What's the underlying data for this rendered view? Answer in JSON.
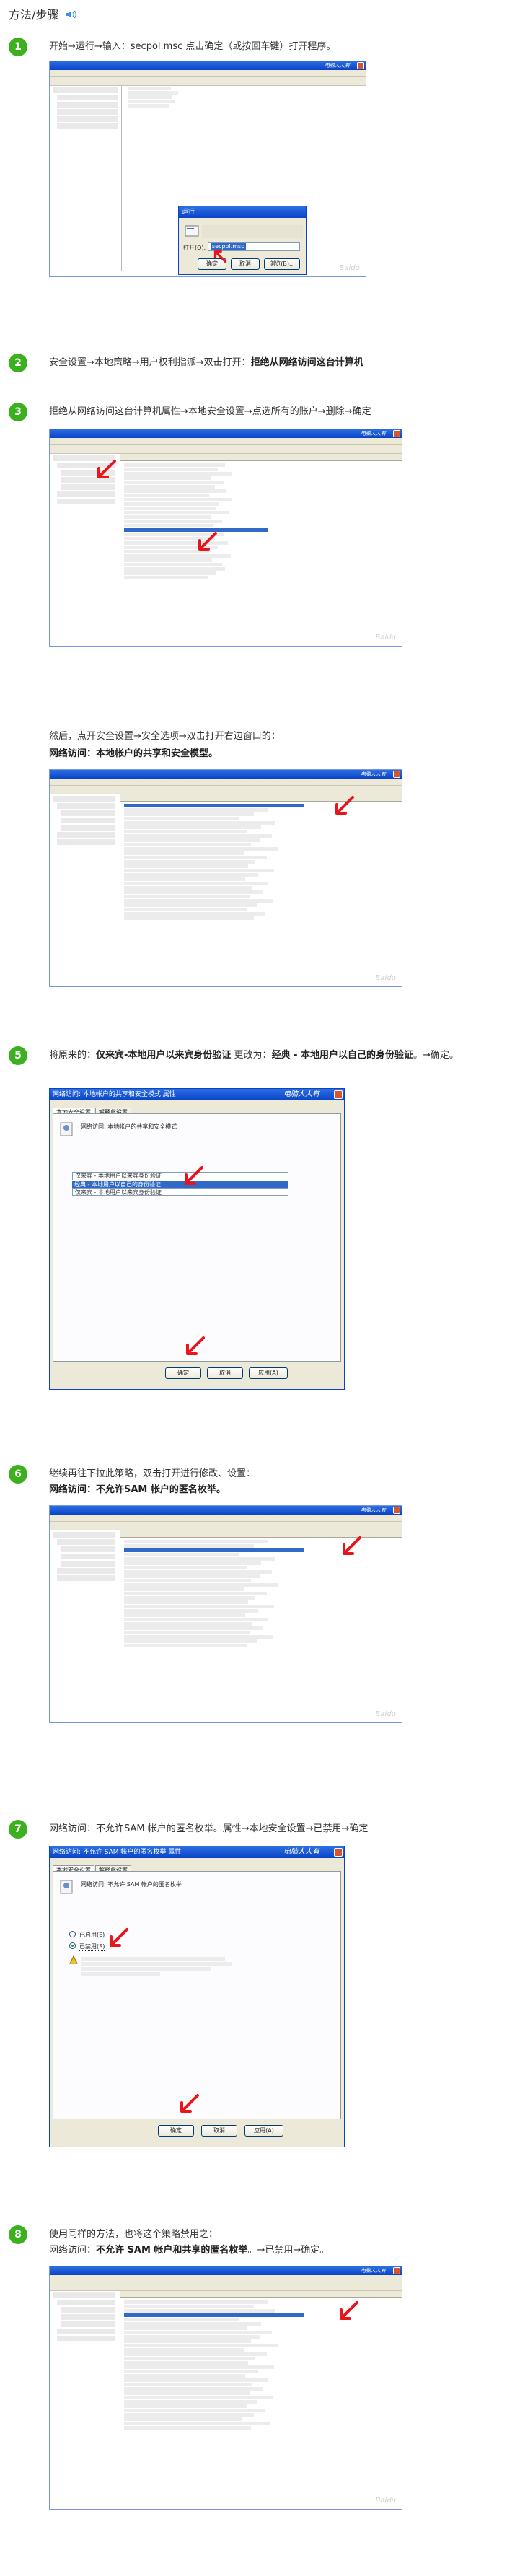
{
  "header": {
    "title": "方法/步骤"
  },
  "steps": [
    {
      "number": "1",
      "text": "开始→运行→输入：secpol.msc 点击确定（或按回车键）打开程序。"
    },
    {
      "number": "2",
      "text_prefix": "安全设置→本地策略→用户权利指派→双击打开：",
      "text_bold": "拒绝从网络访问这台计算机"
    },
    {
      "number": "3",
      "text": "拒绝从网络访问这台计算机属性→本地安全设置→点选所有的账户→删除→确定",
      "extra_text": "然后，点开安全设置→安全选项→双击打开右边窗口的：",
      "extra_bold": "网络访问：本地帐户的共享和安全模型。"
    },
    {
      "number": "5",
      "text_prefix": "将原来的：",
      "text_bold1": "仅来宾-本地用户以来宾身份验证",
      "text_mid": " 更改为：",
      "text_bold2": "经典 - 本地用户以自己的身份验证",
      "text_suffix": "。→确定。"
    },
    {
      "number": "6",
      "text": "继续再往下拉此策略，双击打开进行修改、设置：",
      "extra_bold": "网络访问：不允许SAM 帐户的匿名枚举。"
    },
    {
      "number": "7",
      "text": "网络访问：不允许SAM 帐户的匿名枚举。属性→本地安全设置→已禁用→确定"
    },
    {
      "number": "8",
      "text": "使用同样的方法，也将这个策略禁用之：",
      "extra_prefix": "网络访问：",
      "extra_bold": "不允许 SAM 帐户和共享的匿名枚举",
      "extra_suffix": "。→已禁用→确定。"
    }
  ],
  "screens": {
    "brand": "电脑人人有",
    "run_dialog": {
      "title": "运行",
      "field_label": "打开(O):",
      "value": "secpol.msc",
      "ok": "确定",
      "cancel": "取消",
      "browse": "浏览(B)..."
    },
    "dialog5": {
      "title": "网络访问: 本地帐户的共享和安全模式 属性",
      "tab1": "本地安全设置",
      "tab2": "解释此设置",
      "policy": "网络访问: 本地帐户的共享和安全模式",
      "selected": "仅来宾 - 本地用户以来宾身份验证",
      "option1": "经典 - 本地用户以自己的身份验证",
      "option2": "仅来宾 - 本地用户以来宾身份验证",
      "ok": "确定",
      "cancel": "取消",
      "apply": "应用(A)"
    },
    "dialog7": {
      "title": "网络访问: 不允许 SAM 帐户的匿名枚举 属性",
      "tab1": "本地安全设置",
      "tab2": "解释此设置",
      "policy": "网络访问: 不允许 SAM 帐户的匿名枚举",
      "enabled": "已启用(E)",
      "disabled": "已禁用(S)",
      "ok": "确定",
      "cancel": "取消",
      "apply": "应用(A)"
    }
  },
  "colors": {
    "badge": "#3db01f",
    "arrow": "#e8161b",
    "selection": "#3169c6"
  }
}
